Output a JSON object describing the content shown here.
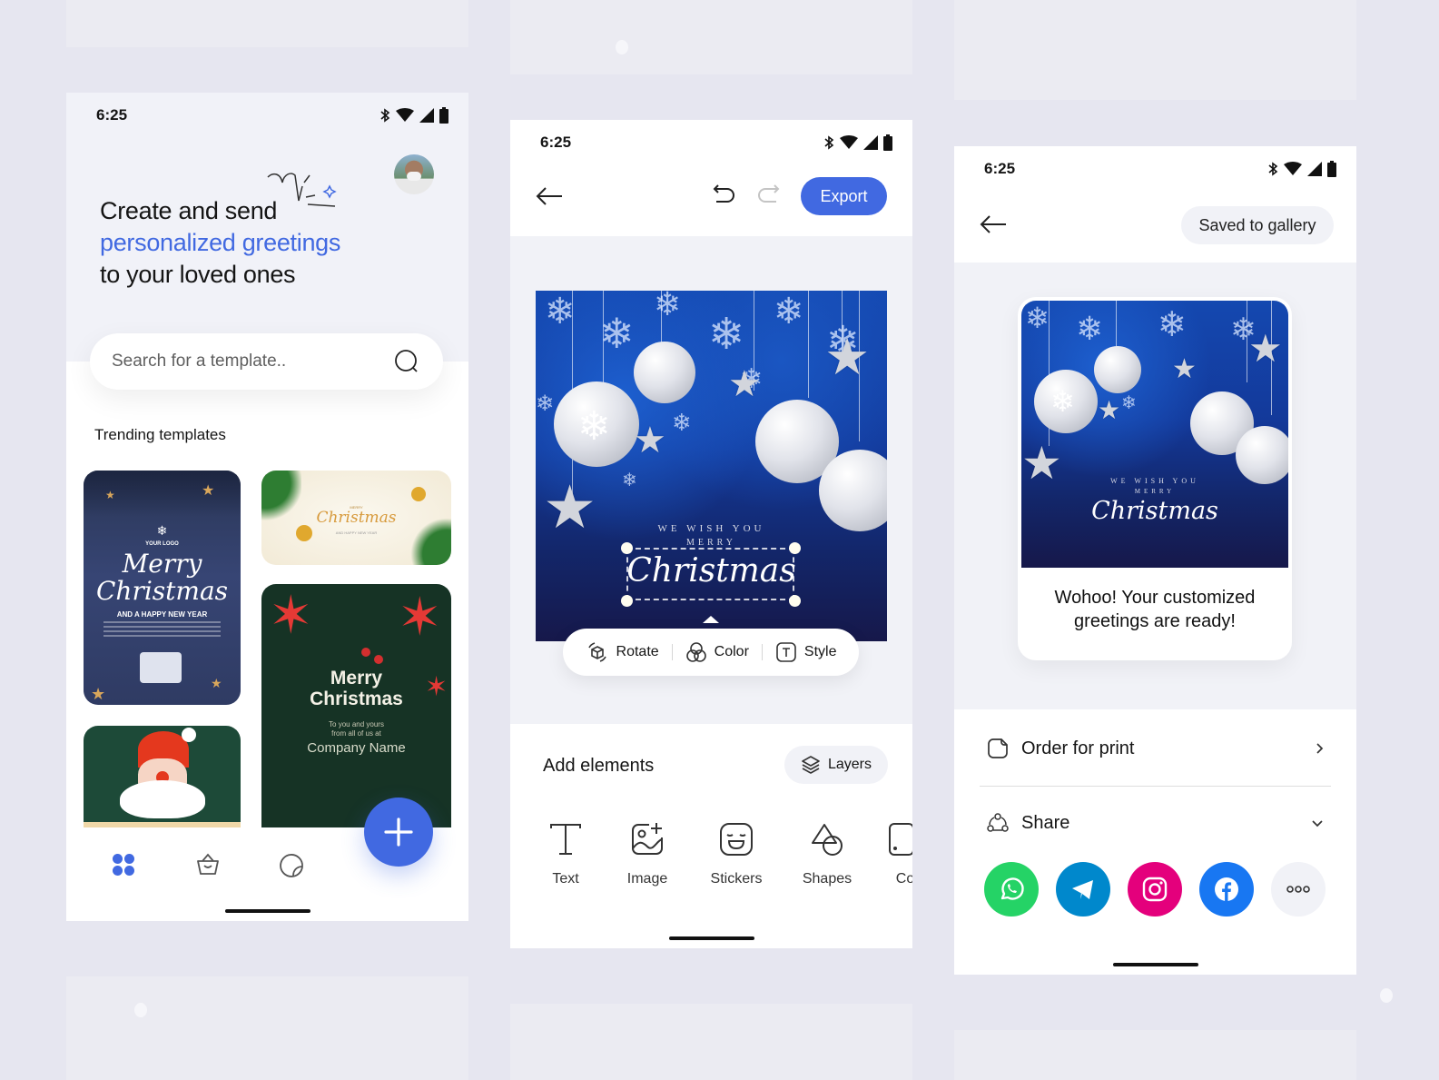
{
  "status_bar": {
    "time": "6:25"
  },
  "home": {
    "headline": {
      "line1": "Create and send",
      "line2": "personalized greetings",
      "line3": "to your loved ones"
    },
    "search": {
      "placeholder": "Search for a template.."
    },
    "trending_title": "Trending templates",
    "templates": [
      {
        "title": "Merry Christmas",
        "subtitle": "AND A HAPPY NEW YEAR",
        "logo": "YOUR LOGO"
      },
      {
        "title": "Christmas",
        "top": "MERRY",
        "subtitle": "AND HAPPY NEW YEAR"
      },
      {
        "title": "Santa"
      },
      {
        "title_line1": "Merry",
        "title_line2": "Christmas",
        "sub1": "To you and yours",
        "sub2": "from all of us at",
        "company": "Company Name"
      }
    ],
    "nav": [
      "templates",
      "basket",
      "stickers"
    ],
    "fab_icon": "plus-icon"
  },
  "editor": {
    "export_label": "Export",
    "card": {
      "wish": "WE WISH YOU",
      "merry": "MERRY",
      "script": "Christmas"
    },
    "context_menu": [
      {
        "label": "Rotate",
        "icon": "rotate-cube-icon"
      },
      {
        "label": "Color",
        "icon": "color-circles-icon"
      },
      {
        "label": "Style",
        "icon": "text-style-icon"
      }
    ],
    "add_elements_title": "Add elements",
    "layers_label": "Layers",
    "tools": [
      {
        "label": "Text",
        "icon": "text-icon"
      },
      {
        "label": "Image",
        "icon": "image-add-icon"
      },
      {
        "label": "Stickers",
        "icon": "sticker-icon"
      },
      {
        "label": "Shapes",
        "icon": "shapes-icon"
      },
      {
        "label": "Co",
        "icon": "device-icon"
      }
    ]
  },
  "share": {
    "saved_label": "Saved to gallery",
    "card": {
      "wish": "WE WISH YOU",
      "merry": "MERRY",
      "script": "Christmas"
    },
    "ready_text_line1": "Wohoo! Your customized",
    "ready_text_line2": "greetings are ready!",
    "order_label": "Order for print",
    "share_label": "Share",
    "apps": [
      {
        "name": "WhatsApp",
        "color": "#25d366"
      },
      {
        "name": "Telegram",
        "color": "#0088cc"
      },
      {
        "name": "Instagram",
        "color": "#e4007c"
      },
      {
        "name": "Facebook",
        "color": "#1877f2"
      },
      {
        "name": "More",
        "color": "#f1f2f7"
      }
    ]
  },
  "colors": {
    "accent": "#4169e1",
    "background": "#e6e6f0"
  }
}
